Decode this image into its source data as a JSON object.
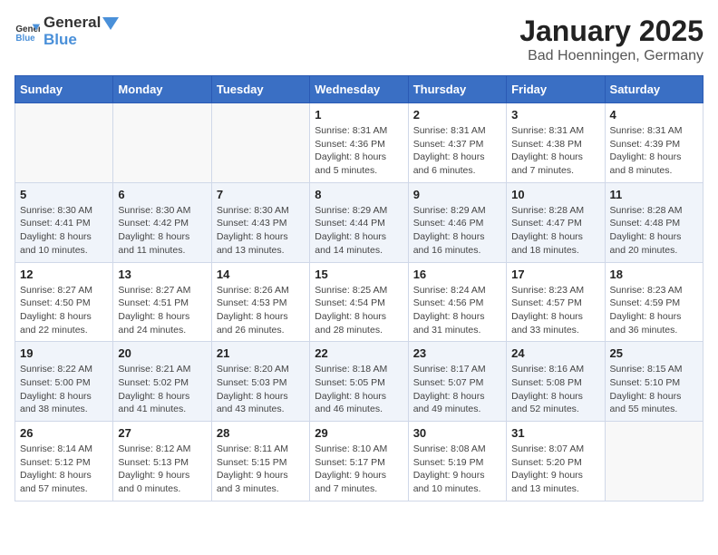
{
  "header": {
    "logo_general": "General",
    "logo_blue": "Blue",
    "title": "January 2025",
    "subtitle": "Bad Hoenningen, Germany"
  },
  "weekdays": [
    "Sunday",
    "Monday",
    "Tuesday",
    "Wednesday",
    "Thursday",
    "Friday",
    "Saturday"
  ],
  "weeks": [
    [
      {
        "day": "",
        "info": ""
      },
      {
        "day": "",
        "info": ""
      },
      {
        "day": "",
        "info": ""
      },
      {
        "day": "1",
        "info": "Sunrise: 8:31 AM\nSunset: 4:36 PM\nDaylight: 8 hours\nand 5 minutes."
      },
      {
        "day": "2",
        "info": "Sunrise: 8:31 AM\nSunset: 4:37 PM\nDaylight: 8 hours\nand 6 minutes."
      },
      {
        "day": "3",
        "info": "Sunrise: 8:31 AM\nSunset: 4:38 PM\nDaylight: 8 hours\nand 7 minutes."
      },
      {
        "day": "4",
        "info": "Sunrise: 8:31 AM\nSunset: 4:39 PM\nDaylight: 8 hours\nand 8 minutes."
      }
    ],
    [
      {
        "day": "5",
        "info": "Sunrise: 8:30 AM\nSunset: 4:41 PM\nDaylight: 8 hours\nand 10 minutes."
      },
      {
        "day": "6",
        "info": "Sunrise: 8:30 AM\nSunset: 4:42 PM\nDaylight: 8 hours\nand 11 minutes."
      },
      {
        "day": "7",
        "info": "Sunrise: 8:30 AM\nSunset: 4:43 PM\nDaylight: 8 hours\nand 13 minutes."
      },
      {
        "day": "8",
        "info": "Sunrise: 8:29 AM\nSunset: 4:44 PM\nDaylight: 8 hours\nand 14 minutes."
      },
      {
        "day": "9",
        "info": "Sunrise: 8:29 AM\nSunset: 4:46 PM\nDaylight: 8 hours\nand 16 minutes."
      },
      {
        "day": "10",
        "info": "Sunrise: 8:28 AM\nSunset: 4:47 PM\nDaylight: 8 hours\nand 18 minutes."
      },
      {
        "day": "11",
        "info": "Sunrise: 8:28 AM\nSunset: 4:48 PM\nDaylight: 8 hours\nand 20 minutes."
      }
    ],
    [
      {
        "day": "12",
        "info": "Sunrise: 8:27 AM\nSunset: 4:50 PM\nDaylight: 8 hours\nand 22 minutes."
      },
      {
        "day": "13",
        "info": "Sunrise: 8:27 AM\nSunset: 4:51 PM\nDaylight: 8 hours\nand 24 minutes."
      },
      {
        "day": "14",
        "info": "Sunrise: 8:26 AM\nSunset: 4:53 PM\nDaylight: 8 hours\nand 26 minutes."
      },
      {
        "day": "15",
        "info": "Sunrise: 8:25 AM\nSunset: 4:54 PM\nDaylight: 8 hours\nand 28 minutes."
      },
      {
        "day": "16",
        "info": "Sunrise: 8:24 AM\nSunset: 4:56 PM\nDaylight: 8 hours\nand 31 minutes."
      },
      {
        "day": "17",
        "info": "Sunrise: 8:23 AM\nSunset: 4:57 PM\nDaylight: 8 hours\nand 33 minutes."
      },
      {
        "day": "18",
        "info": "Sunrise: 8:23 AM\nSunset: 4:59 PM\nDaylight: 8 hours\nand 36 minutes."
      }
    ],
    [
      {
        "day": "19",
        "info": "Sunrise: 8:22 AM\nSunset: 5:00 PM\nDaylight: 8 hours\nand 38 minutes."
      },
      {
        "day": "20",
        "info": "Sunrise: 8:21 AM\nSunset: 5:02 PM\nDaylight: 8 hours\nand 41 minutes."
      },
      {
        "day": "21",
        "info": "Sunrise: 8:20 AM\nSunset: 5:03 PM\nDaylight: 8 hours\nand 43 minutes."
      },
      {
        "day": "22",
        "info": "Sunrise: 8:18 AM\nSunset: 5:05 PM\nDaylight: 8 hours\nand 46 minutes."
      },
      {
        "day": "23",
        "info": "Sunrise: 8:17 AM\nSunset: 5:07 PM\nDaylight: 8 hours\nand 49 minutes."
      },
      {
        "day": "24",
        "info": "Sunrise: 8:16 AM\nSunset: 5:08 PM\nDaylight: 8 hours\nand 52 minutes."
      },
      {
        "day": "25",
        "info": "Sunrise: 8:15 AM\nSunset: 5:10 PM\nDaylight: 8 hours\nand 55 minutes."
      }
    ],
    [
      {
        "day": "26",
        "info": "Sunrise: 8:14 AM\nSunset: 5:12 PM\nDaylight: 8 hours\nand 57 minutes."
      },
      {
        "day": "27",
        "info": "Sunrise: 8:12 AM\nSunset: 5:13 PM\nDaylight: 9 hours\nand 0 minutes."
      },
      {
        "day": "28",
        "info": "Sunrise: 8:11 AM\nSunset: 5:15 PM\nDaylight: 9 hours\nand 3 minutes."
      },
      {
        "day": "29",
        "info": "Sunrise: 8:10 AM\nSunset: 5:17 PM\nDaylight: 9 hours\nand 7 minutes."
      },
      {
        "day": "30",
        "info": "Sunrise: 8:08 AM\nSunset: 5:19 PM\nDaylight: 9 hours\nand 10 minutes."
      },
      {
        "day": "31",
        "info": "Sunrise: 8:07 AM\nSunset: 5:20 PM\nDaylight: 9 hours\nand 13 minutes."
      },
      {
        "day": "",
        "info": ""
      }
    ]
  ]
}
